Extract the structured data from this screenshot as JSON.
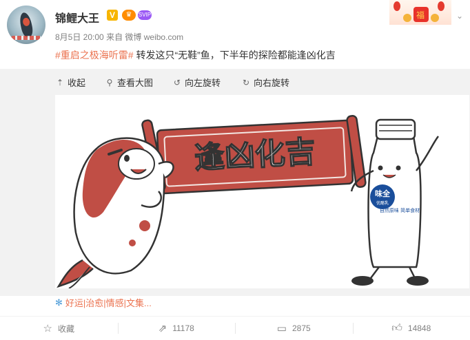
{
  "post": {
    "user_name": "锦鲤大王",
    "badges": {
      "verified": "V",
      "crown": "♛",
      "svip": "SVIP"
    },
    "date": "8月5日 20:00",
    "from_label": "来自",
    "source": "微博 weibo.com",
    "hashtag": "#重启之极海听雷#",
    "text": "转发这只“无鞋”鱼，下半年的探险都能逢凶化吉"
  },
  "media_toolbar": {
    "collapse": "收起",
    "view_large": "查看大图",
    "rotate_left": "向左旋转",
    "rotate_right": "向右旋转"
  },
  "image": {
    "banner_text": "逢凶化吉",
    "bottle_brand_1": "味全",
    "bottle_brand_2": "优酪乳",
    "bottle_text": "自然原味 简单食材"
  },
  "topics": "好运|治愈|情感|文集...",
  "actions": {
    "favorite": "收藏",
    "repost_count": "11178",
    "comment_count": "2875",
    "like_count": "14848"
  },
  "colors": {
    "accent": "#eb7350",
    "banner_red": "#c04e45",
    "topic_blue": "#4b9bd8"
  }
}
